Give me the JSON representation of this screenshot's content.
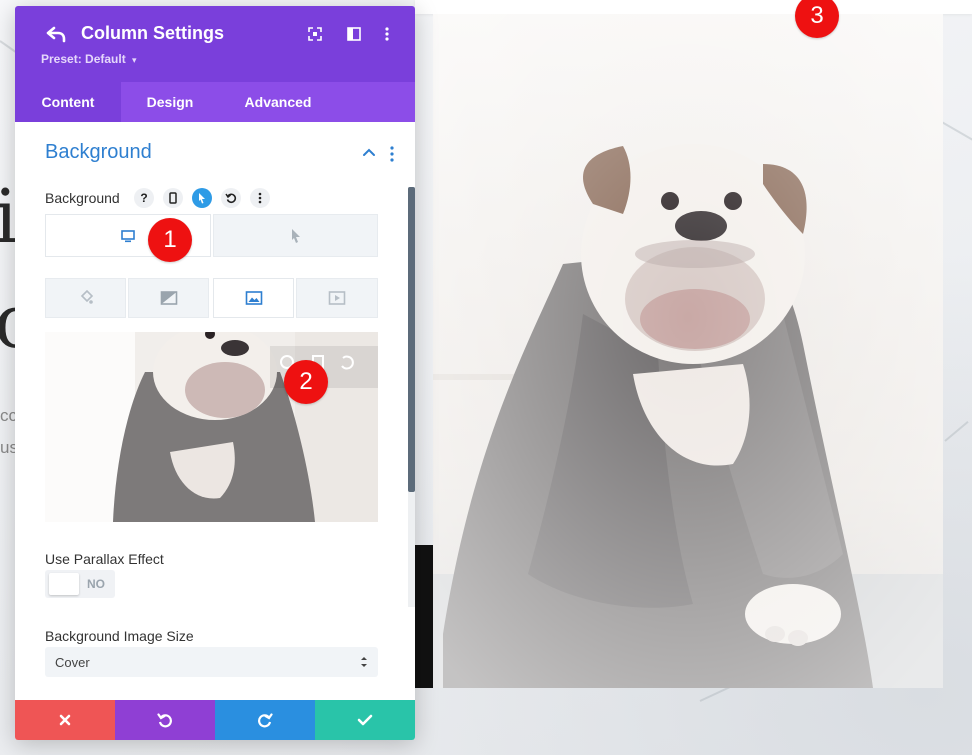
{
  "window": {
    "title": "Column Settings",
    "preset": "Preset: Default"
  },
  "tabs": [
    {
      "label": "Content",
      "active": true
    },
    {
      "label": "Design",
      "active": false
    },
    {
      "label": "Advanced",
      "active": false
    }
  ],
  "section": {
    "title": "Background"
  },
  "background_field": {
    "label": "Background",
    "help": "?"
  },
  "toggle_parallax": {
    "label": "Use Parallax Effect",
    "value": "NO"
  },
  "image_size": {
    "label": "Background Image Size",
    "value": "Cover"
  },
  "badges": [
    "1",
    "2",
    "3"
  ],
  "page_background": {
    "letters": [
      "i",
      "o"
    ],
    "fragments": [
      "cc",
      "us"
    ]
  },
  "colors": {
    "header": "#7a3fdb",
    "tabs": "#8c4de8",
    "accent_blue": "#2e7fd0",
    "cancel": "#ef5555",
    "undo": "#8f3fd4",
    "redo": "#2a8fe0",
    "save": "#29c4a9",
    "badge": "#ee1111"
  },
  "icons": {
    "back": "undo-arrow-icon",
    "fullscreen": "expand-icon",
    "split": "columns-icon",
    "more": "kebab-icon",
    "desktop": "desktop-icon",
    "hover": "cursor-icon",
    "color": "paint-bucket-icon",
    "gradient": "gradient-icon",
    "image": "image-icon",
    "video": "video-icon",
    "cancel": "close-icon",
    "undo": "undo-icon",
    "redo": "redo-icon",
    "save": "check-icon"
  }
}
